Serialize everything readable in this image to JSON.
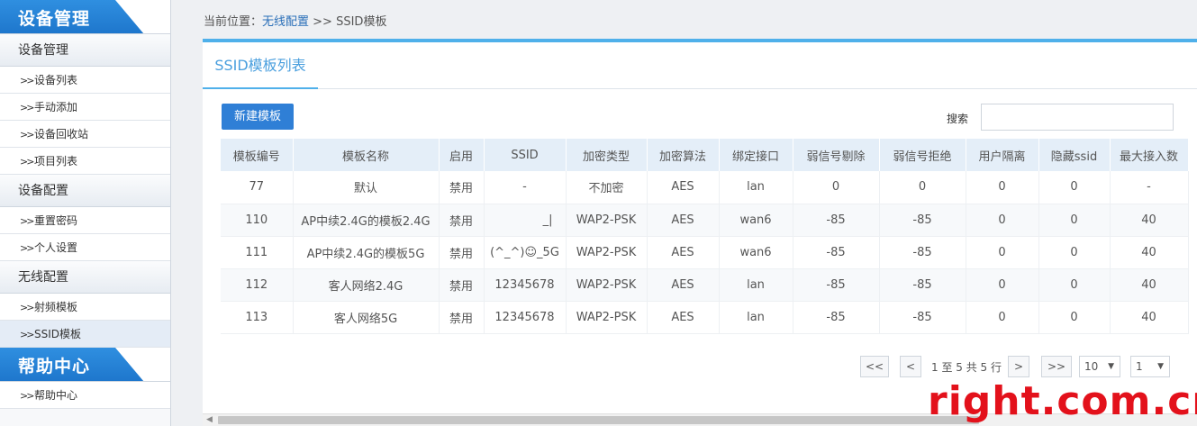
{
  "sidebar": {
    "sections": [
      {
        "title": "设备管理"
      },
      {
        "title": "帮助中心"
      }
    ],
    "groups": {
      "device_mgmt": "设备管理",
      "device_config": "设备配置",
      "wireless_config": "无线配置"
    },
    "items": {
      "device_list": "设备列表",
      "manual_add": "手动添加",
      "device_recycle": "设备回收站",
      "project_list": "项目列表",
      "reset_password": "重置密码",
      "personal_settings": "个人设置",
      "rf_template": "射频模板",
      "ssid_template": "SSID模板",
      "help_center": "帮助中心"
    },
    "chevron": ">>"
  },
  "breadcrumb": {
    "prefix": "当前位置：",
    "link": "无线配置",
    "separator": " >> ",
    "current": "SSID模板"
  },
  "panel": {
    "tab": "SSID模板列表",
    "new_button": "新建模板",
    "search_label": "搜索",
    "search_value": ""
  },
  "table": {
    "headers": [
      "模板编号",
      "模板名称",
      "启用",
      "SSID",
      "加密类型",
      "加密算法",
      "绑定接口",
      "弱信号剔除",
      "弱信号拒绝",
      "用户隔离",
      "隐藏ssid",
      "最大接入数"
    ],
    "rows": [
      [
        "77",
        "默认",
        "禁用",
        "-",
        "不加密",
        "AES",
        "lan",
        "0",
        "0",
        "0",
        "0",
        "-"
      ],
      [
        "110",
        "AP中续2.4G的模板2.4G",
        "禁用",
        "_|",
        "WAP2-PSK",
        "AES",
        "wan6",
        "-85",
        "-85",
        "0",
        "0",
        "40"
      ],
      [
        "111",
        "AP中续2.4G的模板5G",
        "禁用",
        "(^_^)☺_5G",
        "WAP2-PSK",
        "AES",
        "wan6",
        "-85",
        "-85",
        "0",
        "0",
        "40"
      ],
      [
        "112",
        "客人网络2.4G",
        "禁用",
        "12345678",
        "WAP2-PSK",
        "AES",
        "lan",
        "-85",
        "-85",
        "0",
        "0",
        "40"
      ],
      [
        "113",
        "客人网络5G",
        "禁用",
        "12345678",
        "WAP2-PSK",
        "AES",
        "lan",
        "-85",
        "-85",
        "0",
        "0",
        "40"
      ]
    ]
  },
  "pagination": {
    "first": "<<",
    "prev": "<",
    "info": "1 至 5 共 5 行",
    "next": ">",
    "last": ">>",
    "page_size": "10",
    "page": "1"
  },
  "watermark": "right.com.cn",
  "colors": {
    "accent": "#2f7fd6",
    "tab_blue": "#4fb0ea",
    "watermark_red": "#e3111b"
  }
}
